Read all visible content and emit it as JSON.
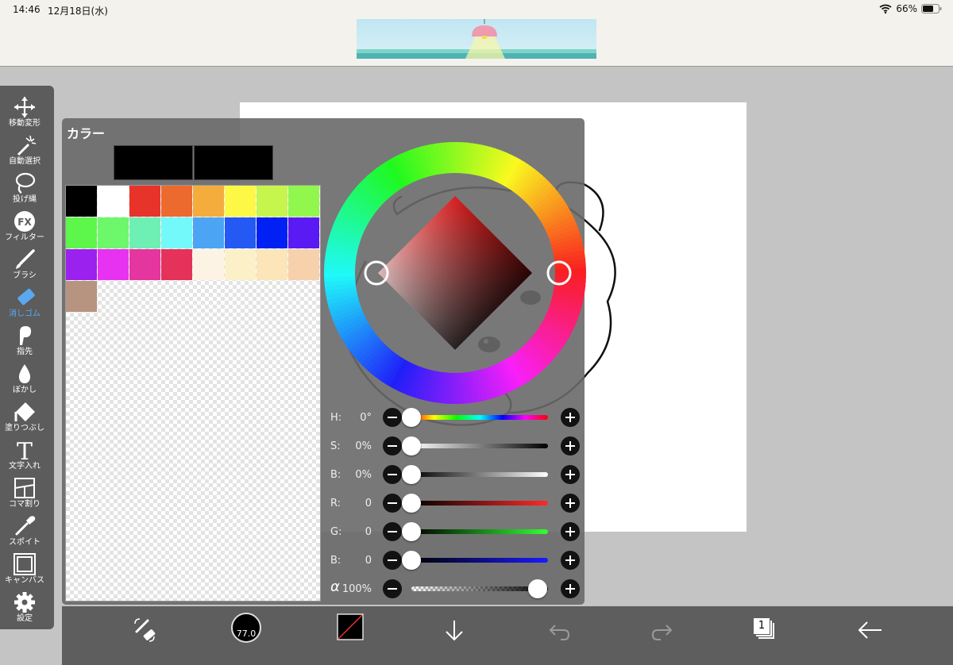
{
  "status_bar": {
    "time": "14:46",
    "date": "12月18日(水)",
    "battery": "66%",
    "wifi_icon": "wifi-icon",
    "battery_icon": "battery-icon"
  },
  "toolbar": {
    "items": [
      {
        "label": "移動変形",
        "icon": "move-arrows-icon"
      },
      {
        "label": "自動選択",
        "icon": "magic-wand-icon"
      },
      {
        "label": "投げ縄",
        "icon": "lasso-icon"
      },
      {
        "label": "フィルター",
        "icon": "fx-icon",
        "icon_text": "FX"
      },
      {
        "label": "ブラシ",
        "icon": "brush-icon"
      },
      {
        "label": "消しゴム",
        "icon": "eraser-icon",
        "active": true
      },
      {
        "label": "指先",
        "icon": "finger-smudge-icon"
      },
      {
        "label": "ぼかし",
        "icon": "blur-drop-icon"
      },
      {
        "label": "塗りつぶし",
        "icon": "fill-bucket-icon"
      },
      {
        "label": "文字入れ",
        "icon": "text-icon",
        "icon_text": "T"
      },
      {
        "label": "コマ割り",
        "icon": "panel-divide-icon"
      },
      {
        "label": "スポイト",
        "icon": "eyedropper-icon"
      },
      {
        "label": "キャンバス",
        "icon": "canvas-icon"
      },
      {
        "label": "設定",
        "icon": "gear-icon"
      }
    ],
    "active_color": "#5aa8f0"
  },
  "color_panel": {
    "title": "カラー",
    "current_color": "#000000",
    "previous_color": "#000000",
    "palette": [
      "#000000",
      "#ffffff",
      "#e8332a",
      "#ed6a2e",
      "#f4ac3d",
      "#fdf846",
      "#c6f64b",
      "#91f74c",
      "#5cf74a",
      "#6cf86a",
      "#6ef0b4",
      "#73f9f9",
      "#4ba4f4",
      "#2459f4",
      "#0020f4",
      "#5a1af4",
      "#9b22ee",
      "#e733f1",
      "#e5359e",
      "#e5325a",
      "#fcf3e4",
      "#fcf0c8",
      "#fbe5b9",
      "#f6d1ac",
      "#b79480"
    ],
    "sliders": [
      {
        "key": "hue",
        "label": "H:",
        "value": "0°",
        "fraction": 0.0
      },
      {
        "key": "saturation",
        "label": "S:",
        "value": "0%",
        "fraction": 0.0
      },
      {
        "key": "brightness",
        "label": "B:",
        "value": "0%",
        "fraction": 0.0
      },
      {
        "key": "red",
        "label": "R:",
        "value": "0",
        "fraction": 0.0
      },
      {
        "key": "green",
        "label": "G:",
        "value": "0",
        "fraction": 0.0
      },
      {
        "key": "blue",
        "label": "B:",
        "value": "0",
        "fraction": 0.0
      },
      {
        "key": "alpha",
        "label": "α",
        "value": "100%",
        "fraction": 1.0
      }
    ]
  },
  "bottom_bar": {
    "brush_size": "77.0",
    "layer_count": "1",
    "icons": [
      "swap-tool-icon",
      "brush-size-icon",
      "color-preview-icon",
      "download-arrow-icon",
      "undo-icon",
      "redo-icon",
      "layers-icon",
      "back-arrow-icon"
    ]
  }
}
